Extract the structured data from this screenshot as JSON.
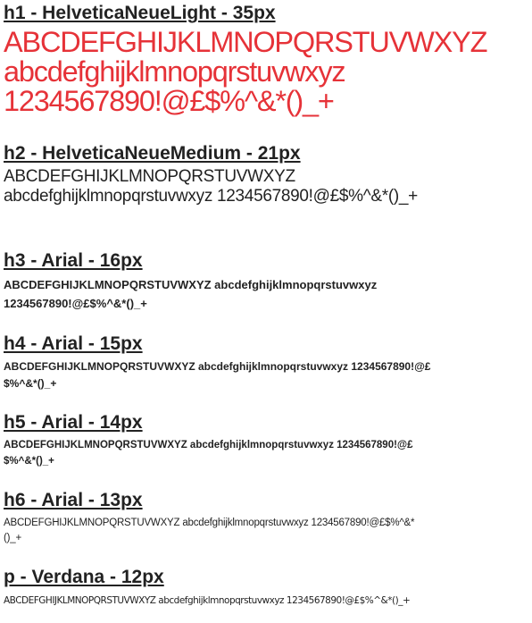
{
  "sections": [
    {
      "id": "h1",
      "heading": "h1 - HelveticaNeueLight - 35px",
      "lines": [
        "ABCDEFGHIJKLMNOPQRSTUVWXYZ",
        "abcdefghijklmnopqrstuvwxyz",
        "1234567890!@£$%^&*()_+"
      ]
    },
    {
      "id": "h2",
      "heading": "h2 - HelveticaNeueMedium - 21px",
      "text": "ABCDEFGHIJKLMNOPQRSTUVWXYZ abcdefghijklmnopqrstuvwxyz 1234567890!@£$%^&*()_+"
    },
    {
      "id": "h3",
      "heading": "h3 - Arial - 16px",
      "text": "ABCDEFGHIJKLMNOPQRSTUVWXYZ abcdefghijklmnopqrstuvwxyz 1234567890!@£$%^&*()_+"
    },
    {
      "id": "h4",
      "heading": "h4 - Arial - 15px",
      "text": "ABCDEFGHIJKLMNOPQRSTUVWXYZ abcdefghijklmnopqrstuvwxyz 1234567890!@£$%^&*()_+"
    },
    {
      "id": "h5",
      "heading": "h5 - Arial - 14px",
      "text": "ABCDEFGHIJKLMNOPQRSTUVWXYZ abcdefghijklmnopqrstuvwxyz 1234567890!@£$%^&*()_+"
    },
    {
      "id": "h6",
      "heading": "h6 - Arial - 13px",
      "text": "ABCDEFGHIJKLMNOPQRSTUVWXYZ abcdefghijklmnopqrstuvwxyz 1234567890!@£$%^&*()_+"
    },
    {
      "id": "p",
      "heading": "p - Verdana - 12px",
      "text": "ABCDEFGHIJKLMNOPQRSTUVWXYZ abcdefghijklmnopqrstuvwxyz 1234567890!@£$%^&*()_+"
    }
  ],
  "colors": {
    "h1_sample": "#e63238",
    "text": "#222222",
    "background": "#ffffff"
  }
}
